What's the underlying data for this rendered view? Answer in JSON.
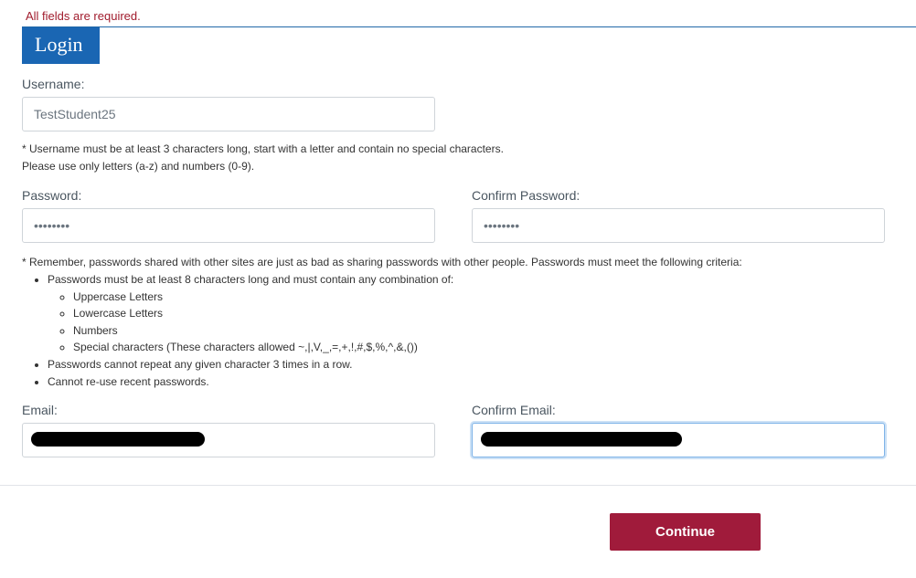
{
  "error_message": "All fields are required.",
  "section_title": "Login",
  "username": {
    "label": "Username:",
    "value": "TestStudent25",
    "hint_line1": "* Username must be at least 3 characters long, start with a letter and contain no special characters.",
    "hint_line2": "Please use only letters (a-z) and numbers (0-9)."
  },
  "password": {
    "label": "Password:",
    "value": "••••••••"
  },
  "confirm_password": {
    "label": "Confirm Password:",
    "value": "••••••••"
  },
  "password_rules": {
    "intro": "* Remember, passwords shared with other sites are just as bad as sharing passwords with other people. Passwords must meet the following criteria:",
    "rule1": "Passwords must be at least 8 characters long and must contain any combination of:",
    "sub1": "Uppercase Letters",
    "sub2": "Lowercase Letters",
    "sub3": "Numbers",
    "sub4": "Special characters (These characters allowed ~,|,V,_,=,+,!,#,$,%,^,&,())",
    "rule2": "Passwords cannot repeat any given character 3 times in a row.",
    "rule3": "Cannot re-use recent passwords."
  },
  "email": {
    "label": "Email:",
    "value": ""
  },
  "confirm_email": {
    "label": "Confirm Email:",
    "value": ""
  },
  "continue_label": "Continue"
}
